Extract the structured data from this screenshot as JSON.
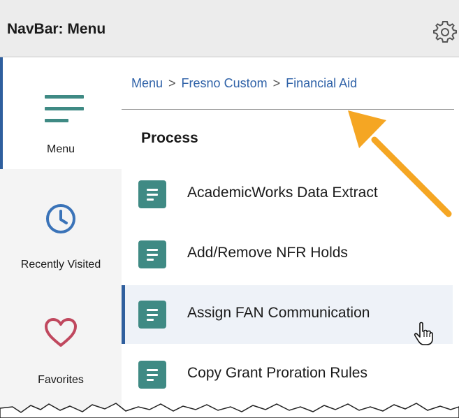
{
  "header": {
    "title": "NavBar: Menu",
    "settings_icon": "gear-icon"
  },
  "sidebar": {
    "items": [
      {
        "label": "Menu",
        "icon": "menu-lines-icon",
        "active": true
      },
      {
        "label": "Recently Visited",
        "icon": "clock-icon",
        "active": false
      },
      {
        "label": "Favorites",
        "icon": "heart-icon",
        "active": false
      }
    ]
  },
  "breadcrumb": {
    "items": [
      "Menu",
      "Fresno Custom",
      "Financial Aid"
    ],
    "separator": ">"
  },
  "section": {
    "title": "Process"
  },
  "list": {
    "items": [
      {
        "label": "AcademicWorks Data Extract"
      },
      {
        "label": "Add/Remove NFR Holds"
      },
      {
        "label": "Assign FAN Communication",
        "hovered": true
      },
      {
        "label": "Copy Grant Proration Rules"
      }
    ]
  },
  "colors": {
    "accent": "#2f5f9e",
    "link": "#2f62a8",
    "tile": "#3f8a84",
    "annotation_arrow": "#f5a623"
  }
}
